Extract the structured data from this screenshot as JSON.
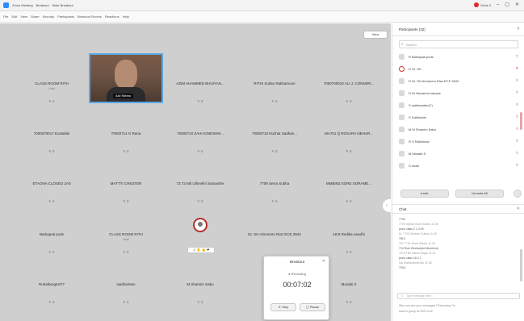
{
  "window": {
    "title": "Zoom Meeting",
    "tabs": [
      "Breakout",
      "Mute Breakout"
    ],
    "user_chip": "Grids 3",
    "rec_color": "#e02828"
  },
  "menubar": {
    "items": [
      "File",
      "Edit",
      "View",
      "Share",
      "Security",
      "Participants",
      "Breakout Rooms",
      "Reactions",
      "Help"
    ]
  },
  "stage": {
    "view_button": "View",
    "tiles_row1": [
      {
        "name": "CLASS ROOM RITH",
        "sub": "Host",
        "icons": "✎ ⚲"
      },
      {
        "name": "",
        "sub": "",
        "icons": ""
      },
      {
        "name": "AZIM AHAMMED BHUIYAN...",
        "sub": "",
        "icons": "✎ ⚲"
      },
      {
        "name": "RITHI Sultan Rakhamoon",
        "sub": "",
        "icons": "✎ ⚲"
      },
      {
        "name": "7000700010 ALI J. CONNOR...",
        "sub": "",
        "icons": "✎ ⚲"
      }
    ],
    "video_name": "Aziz Rahma",
    "tiles_row2": [
      {
        "name": "7000070017 Eustaklin",
        "icons": "✎ ⚲"
      },
      {
        "name": "70000714 G Rana",
        "icons": "✎ ⚲"
      },
      {
        "name": "70000710 ZAHI KOBOIHM...",
        "icons": "✎ ⚲"
      },
      {
        "name": "70000710 Nuzhat Sadhan...",
        "icons": "✎ ⚲"
      },
      {
        "name": "MA701 Q ROSARA NEHAR...",
        "icons": "✎ ⚲"
      }
    ],
    "tiles_row3": [
      {
        "name": "ETAONA CLOSED 2A0",
        "icons": "✎ ⚲"
      },
      {
        "name": "MATTTI CHESTER",
        "icons": "✎ ⚲"
      },
      {
        "name": "73 73 Mb Ullmekhi Samanthe",
        "icons": "✎ ⚲"
      },
      {
        "name": "7709 Serra Subha",
        "icons": "✎ ⚲"
      },
      {
        "name": "MMBIN3 SORE SORAME...",
        "icons": "✎ ⚲"
      }
    ],
    "tiles_row4": [
      {
        "name": "Barkapati pods",
        "sub": "",
        "icons": "✎ ⚲"
      },
      {
        "name": "CLASS ROOM RITH",
        "sub": "Host",
        "icons": "✎ ⚲"
      },
      {
        "name": "",
        "sub": "",
        "icons": ""
      },
      {
        "name": "Dr. SH Ahmmem Riaz ECE 3942",
        "sub": "",
        "icons": ""
      },
      {
        "name": "18 B Redika sasolhi",
        "sub": "",
        "icons": "✎ ⚲"
      }
    ],
    "react_bar": "☺ ✋ 👍 ❤",
    "tiles_row5": [
      {
        "name": "Ruhatbergin077",
        "icons": "✎ ⚲"
      },
      {
        "name": "saidhamtan",
        "icons": "✎ ⚲"
      },
      {
        "name": "M Shamim Sabu",
        "icons": "✎ ⚲"
      },
      {
        "name": "",
        "icons": ""
      },
      {
        "name": "Mosabi S",
        "icons": "✎ ⚲"
      }
    ],
    "side_arrow": "‹"
  },
  "breakout_dialog": {
    "title": "Breakout",
    "status": "● Recording",
    "timer": "00:07:02",
    "btn_left": "✕ Stop",
    "btn_right": "▢ Pause"
  },
  "participants": {
    "title": "Participants (32)",
    "search_placeholder": "Search",
    "rows": [
      {
        "name": "R  Barkapati pods",
        "rec": false,
        "red": false
      },
      {
        "name": "D  Dr. SH",
        "rec": true,
        "red": true
      },
      {
        "name": "D  Dr. SH Ahmmem Riaz ECE 3942",
        "rec": false,
        "red": false
      },
      {
        "name": "D  Dr Mozamot sample",
        "rec": false,
        "red": false
      },
      {
        "name": "S  saidhamtan(Y)",
        "rec": false,
        "red": false
      },
      {
        "name": "S  Saibhadar",
        "rec": false,
        "red": false
      },
      {
        "name": "M  M Shamim Sabu",
        "rec": false,
        "red": false
      },
      {
        "name": "R  S Rakhiman",
        "rec": false,
        "red": false
      },
      {
        "name": "M  Mosabi S",
        "rec": false,
        "red": false
      },
      {
        "name": "S  sivan",
        "rec": false,
        "red": false
      }
    ],
    "invite_label": "Invite",
    "unmute_label": "Unmute All"
  },
  "chat": {
    "title": "Chat",
    "lines": [
      {
        "text": "7703",
        "meta": false
      },
      {
        "text": "7709 Sifyam Nure Subha 11:38",
        "meta": true
      },
      {
        "text": "proof class 2 1 2:09",
        "meta": false
      },
      {
        "text": "Dr. 7700 Shehan Subha 11:40",
        "meta": true
      },
      {
        "text": "7813",
        "meta": false
      },
      {
        "text": "701 7700 Serra Subha 11:43",
        "meta": true
      },
      {
        "text": "710 Roni Ebshan(Ad Mtoluhnn)",
        "meta": false
      },
      {
        "text": "7076 TBh Rehim Begin 11:41",
        "meta": true
      },
      {
        "text": "proof class 18 2 1",
        "meta": false
      },
      {
        "text": "Sai Mathambrist Ahi 11:38",
        "meta": true
      },
      {
        "text": "7003",
        "meta": false
      }
    ],
    "input_placeholder": "Type message here...",
    "footer_line1": "Who can see your messages? Recording On",
    "footer_line2": "save to group at 2022-4:32"
  }
}
